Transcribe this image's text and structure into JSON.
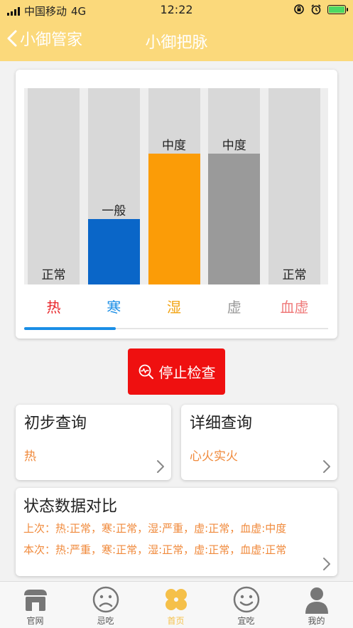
{
  "status_bar": {
    "carrier": "中国移动",
    "network": "4G",
    "time": "12:22"
  },
  "nav": {
    "back_label": "小御管家",
    "title": "小御把脉"
  },
  "chart_data": {
    "type": "bar",
    "categories": [
      "热",
      "寒",
      "湿",
      "虚",
      "血虚"
    ],
    "values": [
      0,
      1,
      2,
      2,
      0
    ],
    "value_labels": [
      "正常",
      "一般",
      "中度",
      "中度",
      "正常"
    ],
    "ylim": [
      0,
      3
    ],
    "bar_colors": [
      "#d8d8d8",
      "#0a66c8",
      "#fb9c07",
      "#9a9a9a",
      "#d8d8d8"
    ],
    "category_colors": [
      "#e8262a",
      "#1a8ee6",
      "#f2a414",
      "#9a9a9a",
      "#ef7a7a"
    ]
  },
  "stop_button": {
    "label": "停止检查",
    "icon": "pulse-search-icon"
  },
  "initial_query": {
    "title": "初步查询",
    "value": "热"
  },
  "detail_query": {
    "title": "详细查询",
    "value": "心火实火"
  },
  "comparison": {
    "title": "状态数据对比",
    "last": "上次：热:正常，寒:正常，湿:严重，虚:正常，血虚:中度",
    "current": "本次：热:严重，寒:正常，湿:正常，虚:正常，血虚:正常"
  },
  "tabbar": {
    "items": [
      {
        "label": "官网",
        "icon": "store-icon"
      },
      {
        "label": "忌吃",
        "icon": "sad-face-icon"
      },
      {
        "label": "首页",
        "icon": "home-clover-icon",
        "active": true
      },
      {
        "label": "宜吃",
        "icon": "happy-face-icon"
      },
      {
        "label": "我的",
        "icon": "user-icon"
      }
    ],
    "active_color": "#f5c04a"
  }
}
